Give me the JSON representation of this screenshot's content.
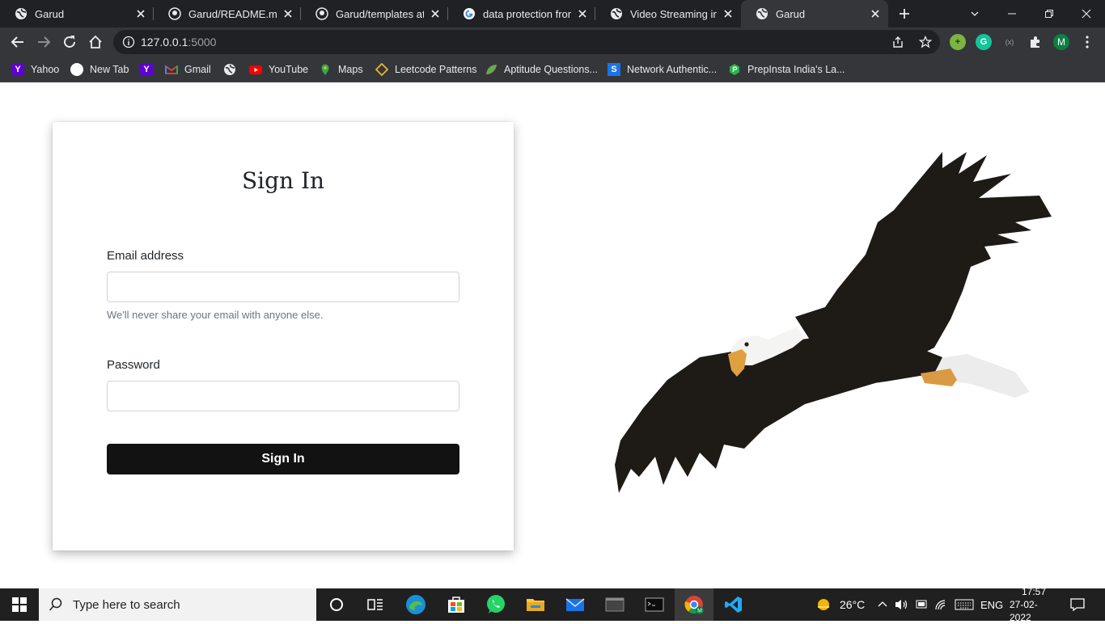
{
  "browser": {
    "tabs": [
      {
        "title": "Garud",
        "favicon": "globe-icon",
        "active": false
      },
      {
        "title": "Garud/README.md at",
        "favicon": "github-icon",
        "active": false
      },
      {
        "title": "Garud/templates at m",
        "favicon": "github-icon",
        "active": false
      },
      {
        "title": "data protection from",
        "favicon": "google-icon",
        "active": false
      },
      {
        "title": "Video Streaming in W",
        "favicon": "globe-icon",
        "active": false
      },
      {
        "title": "Garud",
        "favicon": "globe-icon",
        "active": true
      }
    ],
    "address": {
      "host": "127.0.0.1",
      "port": ":5000"
    },
    "profile_initial": "M",
    "bookmarks": [
      {
        "label": "Yahoo",
        "icon": "yahoo-icon"
      },
      {
        "label": "New Tab",
        "icon": "circle-icon"
      },
      {
        "label": "",
        "icon": "yahoo-icon"
      },
      {
        "label": "Gmail",
        "icon": "gmail-icon"
      },
      {
        "label": "",
        "icon": "globe-icon"
      },
      {
        "label": "YouTube",
        "icon": "youtube-icon"
      },
      {
        "label": "Maps",
        "icon": "maps-icon"
      },
      {
        "label": "Leetcode Patterns",
        "icon": "leetcode-icon"
      },
      {
        "label": "Aptitude Questions...",
        "icon": "leaf-icon"
      },
      {
        "label": "Network Authentic...",
        "icon": "s-icon"
      },
      {
        "label": "PrepInsta India's La...",
        "icon": "prepinsta-icon"
      }
    ]
  },
  "page": {
    "title": "Sign In",
    "email_label": "Email address",
    "email_value": "",
    "email_help": "We'll never share your email with anyone else.",
    "password_label": "Password",
    "password_value": "",
    "submit_label": "Sign In"
  },
  "taskbar": {
    "search_placeholder": "Type here to search",
    "weather": "26°C",
    "language": "ENG",
    "time": "17:57",
    "date": "27-02-2022"
  },
  "colors": {
    "button_bg": "#121212",
    "eagle_body": "#1e1a16",
    "eagle_beak": "#e0a040"
  }
}
